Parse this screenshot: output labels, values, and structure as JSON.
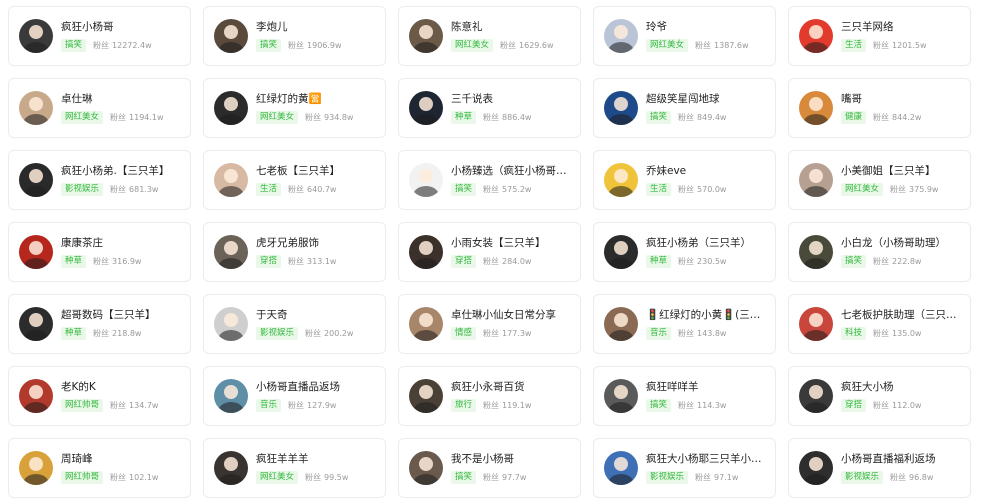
{
  "fans_label": "粉丝",
  "tag_color": "#33b93c",
  "tag_bg": "#eaf8ea",
  "accounts": [
    {
      "name": "疯狂小杨哥",
      "tag": "搞笑",
      "fans": "12272.4w",
      "avatar_icon": "avatar-photo",
      "avatar_color": "#3a3a3a"
    },
    {
      "name": "李炮儿",
      "tag": "搞笑",
      "fans": "1906.9w",
      "avatar_icon": "avatar-photo",
      "avatar_color": "#5a4a3c"
    },
    {
      "name": "陈意礼",
      "tag": "网红美女",
      "fans": "1629.6w",
      "avatar_icon": "avatar-photo",
      "avatar_color": "#6b5a48"
    },
    {
      "name": "玲爷",
      "tag": "网红美女",
      "fans": "1387.6w",
      "avatar_icon": "avatar-photo",
      "avatar_color": "#b9c4d6"
    },
    {
      "name": "三只羊网络",
      "tag": "生活",
      "fans": "1201.5w",
      "avatar_icon": "avatar-logo",
      "avatar_color": "#e23b2e"
    },
    {
      "name": "卓仕琳",
      "tag": "网红美女",
      "fans": "1194.1w",
      "avatar_icon": "avatar-photo",
      "avatar_color": "#c8a98a"
    },
    {
      "name": "红绿灯的黄🈺",
      "tag": "网红美女",
      "fans": "934.8w",
      "avatar_icon": "avatar-photo",
      "avatar_color": "#2b2b2b"
    },
    {
      "name": "三千说表",
      "tag": "种草",
      "fans": "886.4w",
      "avatar_icon": "avatar-photo",
      "avatar_color": "#1e2533"
    },
    {
      "name": "超级笑星闯地球",
      "tag": "搞笑",
      "fans": "849.4w",
      "avatar_icon": "avatar-logo",
      "avatar_color": "#1f4a8a"
    },
    {
      "name": "嘴哥",
      "tag": "健康",
      "fans": "844.2w",
      "avatar_icon": "avatar-photo",
      "avatar_color": "#d9893a"
    },
    {
      "name": "疯狂小杨弟.【三只羊】",
      "tag": "影视娱乐",
      "fans": "681.3w",
      "avatar_icon": "avatar-photo",
      "avatar_color": "#2a2a2a"
    },
    {
      "name": "七老板【三只羊】",
      "tag": "生活",
      "fans": "640.7w",
      "avatar_icon": "avatar-photo",
      "avatar_color": "#d8b9a4"
    },
    {
      "name": "小杨臻选（疯狂小杨哥的...",
      "tag": "搞笑",
      "fans": "575.2w",
      "avatar_icon": "avatar-logo",
      "avatar_color": "#f2f2f2"
    },
    {
      "name": "乔妹eve",
      "tag": "生活",
      "fans": "570.0w",
      "avatar_icon": "avatar-photo",
      "avatar_color": "#f0c43a"
    },
    {
      "name": "小美御姐【三只羊】",
      "tag": "网红美女",
      "fans": "375.9w",
      "avatar_icon": "avatar-photo",
      "avatar_color": "#b6a092"
    },
    {
      "name": "康康茶庄",
      "tag": "种草",
      "fans": "316.9w",
      "avatar_icon": "avatar-photo",
      "avatar_color": "#b5261d"
    },
    {
      "name": "虎牙兄弟服饰",
      "tag": "穿搭",
      "fans": "313.1w",
      "avatar_icon": "avatar-photo",
      "avatar_color": "#6b6258"
    },
    {
      "name": "小雨女装【三只羊】",
      "tag": "穿搭",
      "fans": "284.0w",
      "avatar_icon": "avatar-photo",
      "avatar_color": "#3b302a"
    },
    {
      "name": "疯狂小杨弟（三只羊）",
      "tag": "种草",
      "fans": "230.5w",
      "avatar_icon": "avatar-photo",
      "avatar_color": "#2b2b2b"
    },
    {
      "name": "小白龙（小杨哥助理）",
      "tag": "搞笑",
      "fans": "222.8w",
      "avatar_icon": "avatar-photo",
      "avatar_color": "#4a4a3a"
    },
    {
      "name": "超哥数码【三只羊】",
      "tag": "种草",
      "fans": "218.8w",
      "avatar_icon": "avatar-photo",
      "avatar_color": "#2c2c2c"
    },
    {
      "name": "于天奇",
      "tag": "影视娱乐",
      "fans": "200.2w",
      "avatar_icon": "avatar-photo",
      "avatar_color": "#cfcfcf"
    },
    {
      "name": "卓仕琳小仙女日常分享",
      "tag": "情感",
      "fans": "177.3w",
      "avatar_icon": "avatar-photo",
      "avatar_color": "#a8866a"
    },
    {
      "name": "🚦红绿灯的小黄🚦(三只羊)",
      "tag": "音乐",
      "fans": "143.8w",
      "avatar_icon": "avatar-photo",
      "avatar_color": "#8a6a52"
    },
    {
      "name": "七老板护肤助理（三只羊...",
      "tag": "科技",
      "fans": "135.0w",
      "avatar_icon": "avatar-photo",
      "avatar_color": "#c8463b"
    },
    {
      "name": "老K的K",
      "tag": "网红帅哥",
      "fans": "134.7w",
      "avatar_icon": "avatar-photo",
      "avatar_color": "#b23a2c"
    },
    {
      "name": "小杨哥直播品返场",
      "tag": "音乐",
      "fans": "127.9w",
      "avatar_icon": "avatar-photo",
      "avatar_color": "#5f8fa6"
    },
    {
      "name": "疯狂小永哥百货",
      "tag": "旅行",
      "fans": "119.1w",
      "avatar_icon": "avatar-photo",
      "avatar_color": "#4a4036"
    },
    {
      "name": "疯狂咩咩羊",
      "tag": "搞笑",
      "fans": "114.3w",
      "avatar_icon": "avatar-photo",
      "avatar_color": "#5a5a5a"
    },
    {
      "name": "疯狂大小杨",
      "tag": "穿搭",
      "fans": "112.0w",
      "avatar_icon": "avatar-photo",
      "avatar_color": "#3a3a3a"
    },
    {
      "name": "周琦峰",
      "tag": "网红帅哥",
      "fans": "102.1w",
      "avatar_icon": "avatar-photo",
      "avatar_color": "#d8a13a"
    },
    {
      "name": "疯狂羊羊羊",
      "tag": "网红美女",
      "fans": "99.5w",
      "avatar_icon": "avatar-photo",
      "avatar_color": "#3a3430"
    },
    {
      "name": "我不是小杨哥",
      "tag": "搞笑",
      "fans": "97.7w",
      "avatar_icon": "avatar-photo",
      "avatar_color": "#6a5a4e"
    },
    {
      "name": "疯狂大小杨耶三只羊小卖...",
      "tag": "影视娱乐",
      "fans": "97.1w",
      "avatar_icon": "avatar-photo",
      "avatar_color": "#3f6fb5"
    },
    {
      "name": "小杨哥直播福利返场",
      "tag": "影视娱乐",
      "fans": "96.8w",
      "avatar_icon": "avatar-photo",
      "avatar_color": "#2e2e2e"
    }
  ]
}
